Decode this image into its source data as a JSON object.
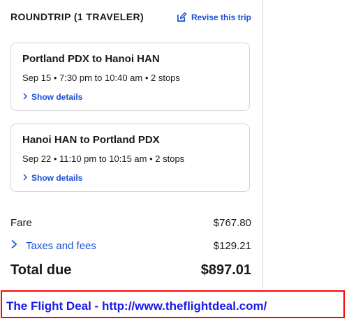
{
  "header": {
    "title": "ROUNDTRIP (1 TRAVELER)",
    "revise_label": "Revise this trip"
  },
  "flights": [
    {
      "route": "Portland PDX to Hanoi HAN",
      "times": "Sep 15 • 7:30 pm to 10:40 am • 2 stops",
      "details_label": "Show details"
    },
    {
      "route": "Hanoi HAN to Portland PDX",
      "times": "Sep 22 • 11:10 pm to 10:15 am • 2 stops",
      "details_label": "Show details"
    }
  ],
  "price": {
    "fare_label": "Fare",
    "fare_value": "$767.80",
    "taxes_label": "Taxes and fees",
    "taxes_value": "$129.21",
    "total_label": "Total due",
    "total_value": "$897.01"
  },
  "banner": {
    "text": "The Flight Deal - http://www.theflightdeal.com/"
  },
  "colors": {
    "link": "#1a4fd6",
    "banner_border": "#ff0000",
    "banner_text": "#1a1ae6"
  },
  "icons": {
    "revise": "edit-icon",
    "details": "chevron-right-icon",
    "taxes": "chevron-right-icon"
  }
}
